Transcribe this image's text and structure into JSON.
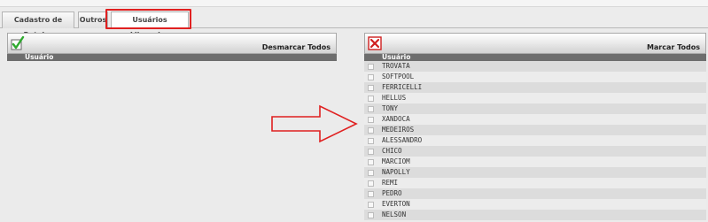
{
  "tabs": [
    {
      "label": "Cadastro de Roteiro"
    },
    {
      "label": "Outros"
    },
    {
      "label": "Usuários Liberados"
    }
  ],
  "left_panel": {
    "action_label": "Desmarcar Todos",
    "column_header": "Usuário",
    "icon": "check-icon"
  },
  "right_panel": {
    "action_label": "Marcar Todos",
    "column_header": "Usuário",
    "icon": "x-icon",
    "users": [
      "TROVATA",
      "SOFTPOOL",
      "FERRICELLI",
      "HELLUS",
      "TONY",
      "XANDOCA",
      "MEDEIROS",
      "ALESSANDRO",
      "CHICO",
      "MARCIOM",
      "NAPOLLY",
      "REMI",
      "PEDRO",
      "EVERTON",
      "NELSON"
    ]
  },
  "annotation": {
    "arrow_color": "#e02020",
    "highlight_color": "#e02020"
  },
  "colors": {
    "check": "#2eaa2e",
    "x_mark": "#d02020",
    "header_bar": "#6d6d6d"
  }
}
